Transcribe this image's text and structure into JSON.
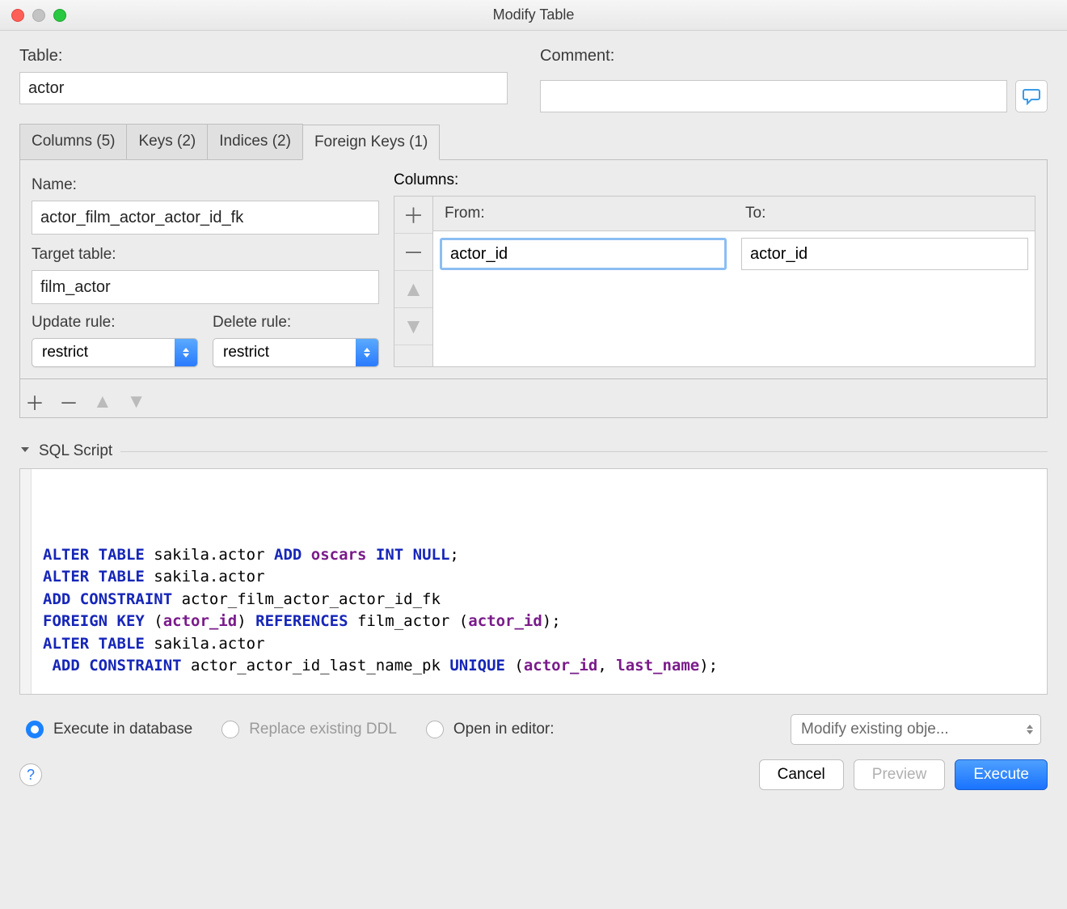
{
  "window_title": "Modify Table",
  "labels": {
    "table": "Table:",
    "comment": "Comment:",
    "name": "Name:",
    "target_table": "Target table:",
    "update_rule": "Update rule:",
    "delete_rule": "Delete rule:",
    "columns": "Columns:",
    "from": "From:",
    "to": "To:"
  },
  "table_name": "actor",
  "comment": "",
  "tabs": [
    {
      "label": "Columns (5)"
    },
    {
      "label": "Keys (2)"
    },
    {
      "label": "Indices (2)"
    },
    {
      "label": "Foreign Keys (1)"
    }
  ],
  "fk": {
    "name": "actor_film_actor_actor_id_fk",
    "target_table": "film_actor",
    "update_rule": "restrict",
    "delete_rule": "restrict",
    "mapping_from": "actor_id",
    "mapping_to": "actor_id"
  },
  "sql_section_title": "SQL Script",
  "sql_tokens": {
    "l1a": "ALTER TABLE",
    "l1b": " sakila.actor ",
    "l1c": "ADD",
    "l1d": " ",
    "l1e": "oscars",
    "l1f": " ",
    "l1g": "INT NULL",
    "l1h": ";",
    "l2a": "ALTER TABLE",
    "l2b": " sakila.actor",
    "l3a": "ADD CONSTRAINT",
    "l3b": " actor_film_actor_actor_id_fk",
    "l4a": "FOREIGN KEY",
    "l4b": " (",
    "l4c": "actor_id",
    "l4d": ") ",
    "l4e": "REFERENCES",
    "l4f": " film_actor (",
    "l4g": "actor_id",
    "l4h": ");",
    "l5a": "ALTER TABLE",
    "l5b": " sakila.actor",
    "l6a": " ADD CONSTRAINT",
    "l6b": " actor_actor_id_last_name_pk ",
    "l6c": "UNIQUE",
    "l6d": " (",
    "l6e": "actor_id",
    "l6f": ", ",
    "l6g": "last_name",
    "l6h": ");"
  },
  "options": {
    "execute_in_db": "Execute in database",
    "replace_ddl": "Replace existing DDL",
    "open_in_editor": "Open in editor:",
    "combo_text": "Modify existing obje..."
  },
  "buttons": {
    "cancel": "Cancel",
    "preview": "Preview",
    "execute": "Execute"
  }
}
